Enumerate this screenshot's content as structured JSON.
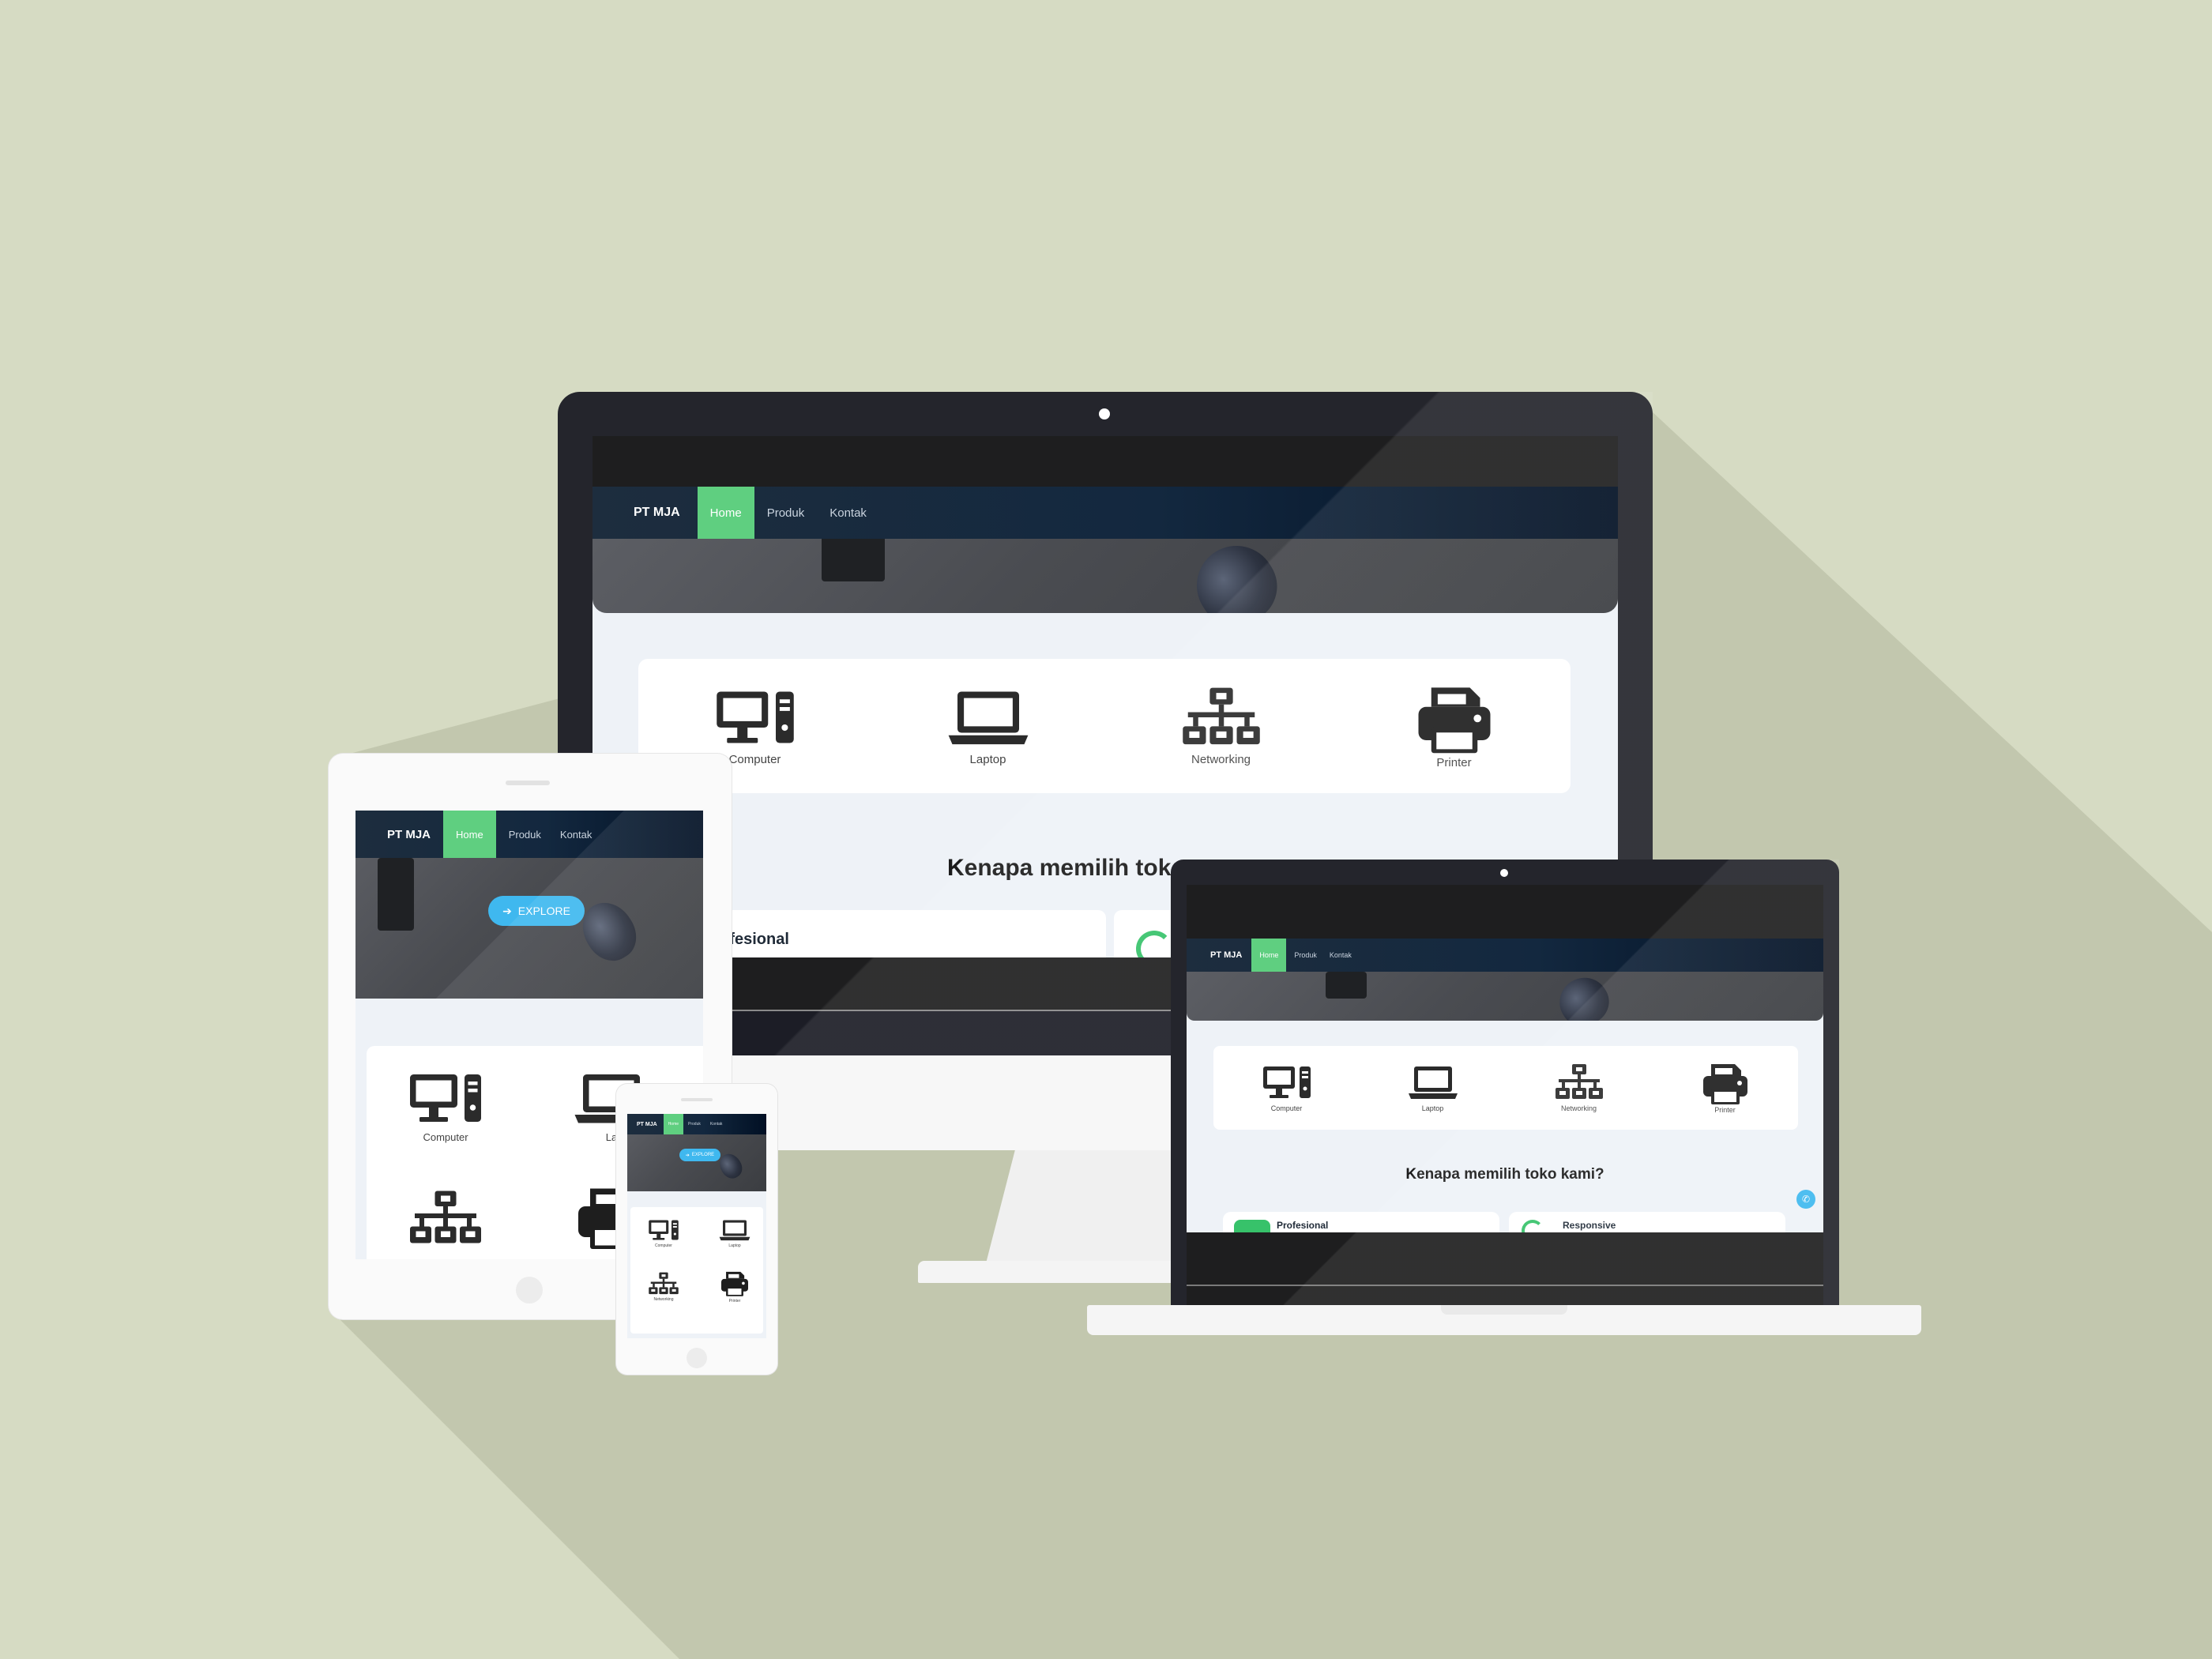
{
  "site": {
    "brand": "PT MJA",
    "nav": [
      "Home",
      "Produk",
      "Kontak"
    ],
    "explore": "EXPLORE",
    "categories": [
      "Computer",
      "Laptop",
      "Networking",
      "Printer"
    ],
    "why_title": "Kenapa memilih toko kami?",
    "why_title_cropped": "Kenapa memilih tok",
    "features": [
      "Profesional",
      "Responsive"
    ],
    "tablet_laptop_cropped": "La"
  },
  "colors": {
    "background": "#d6dbc3",
    "accent_green": "#5fcf80",
    "accent_blue": "#3fb8ef",
    "navbar_dark": "#13283f"
  },
  "icons": {
    "categories": [
      "computer-icon",
      "laptop-icon",
      "networking-icon",
      "printer-icon"
    ],
    "whatsapp": "whatsapp-icon",
    "arrow": "arrow-right-icon"
  }
}
